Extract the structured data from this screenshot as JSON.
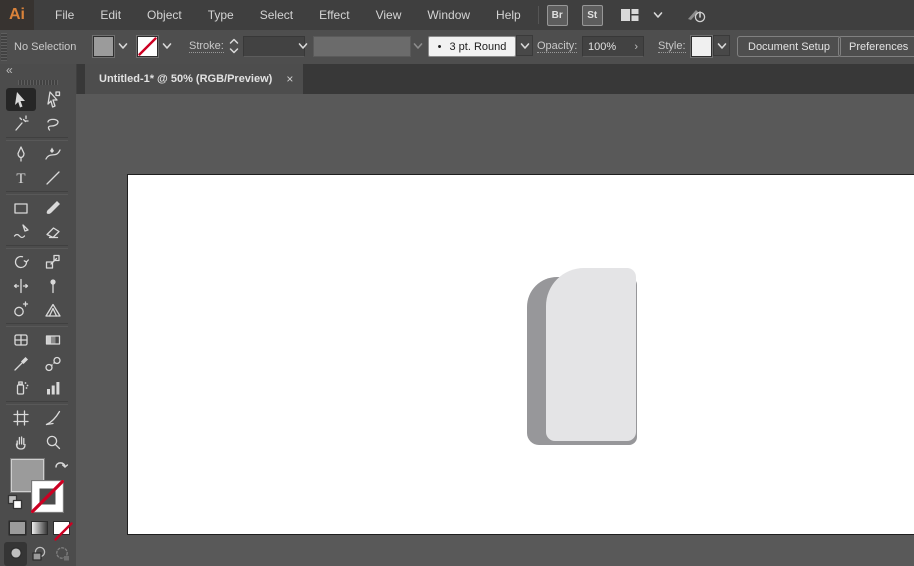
{
  "menu_bar": {
    "logo": "Ai",
    "items": [
      "File",
      "Edit",
      "Object",
      "Type",
      "Select",
      "Effect",
      "View",
      "Window",
      "Help"
    ],
    "bridge_label": "Br",
    "stock_label": "St"
  },
  "control_bar": {
    "selection_status": "No Selection",
    "stroke_label": "Stroke:",
    "brush_bullet": "•",
    "brush_value": "3 pt. Round",
    "opacity_label": "Opacity:",
    "opacity_value": "100%",
    "opacity_arrow": "›",
    "style_label": "Style:",
    "document_setup_label": "Document Setup",
    "preferences_label": "Preferences"
  },
  "tab": {
    "title": "Untitled-1* @ 50% (RGB/Preview)",
    "close_glyph": "×"
  },
  "toolbar": {
    "collapse_glyph": "«",
    "tools": [
      {
        "name": "selection-tool",
        "selected": true
      },
      {
        "name": "direct-selection-tool",
        "selected": false
      },
      {
        "name": "magic-wand-tool",
        "selected": false
      },
      {
        "name": "lasso-tool",
        "selected": false
      },
      {
        "name": "pen-tool",
        "selected": false
      },
      {
        "name": "curvature-tool",
        "selected": false
      },
      {
        "name": "type-tool",
        "selected": false
      },
      {
        "name": "line-segment-tool",
        "selected": false
      },
      {
        "name": "rectangle-tool",
        "selected": false
      },
      {
        "name": "paintbrush-tool",
        "selected": false
      },
      {
        "name": "shaper-tool",
        "selected": false
      },
      {
        "name": "eraser-tool",
        "selected": false
      },
      {
        "name": "rotate-tool",
        "selected": false
      },
      {
        "name": "scale-tool",
        "selected": false
      },
      {
        "name": "width-tool",
        "selected": false
      },
      {
        "name": "puppet-warp-tool",
        "selected": false
      },
      {
        "name": "shape-builder-tool",
        "selected": false
      },
      {
        "name": "perspective-grid-tool",
        "selected": false
      },
      {
        "name": "mesh-tool",
        "selected": false
      },
      {
        "name": "gradient-tool",
        "selected": false
      },
      {
        "name": "eyedropper-tool",
        "selected": false
      },
      {
        "name": "blend-tool",
        "selected": false
      },
      {
        "name": "symbol-sprayer-tool",
        "selected": false
      },
      {
        "name": "column-graph-tool",
        "selected": false
      },
      {
        "name": "artboard-tool",
        "selected": false
      },
      {
        "name": "slice-tool",
        "selected": false
      },
      {
        "name": "hand-tool",
        "selected": false
      },
      {
        "name": "zoom-tool",
        "selected": false
      }
    ],
    "group_breaks_after_row": [
      2,
      4,
      6,
      9,
      12
    ]
  },
  "colors": {
    "fill_swatch": "#9b9b9b",
    "none_slash_red": "#cc0022",
    "artboard": "#ffffff",
    "shape_front": "#e4e4e6",
    "shape_back": "#97979a",
    "logo_orange": "#d9823a"
  }
}
